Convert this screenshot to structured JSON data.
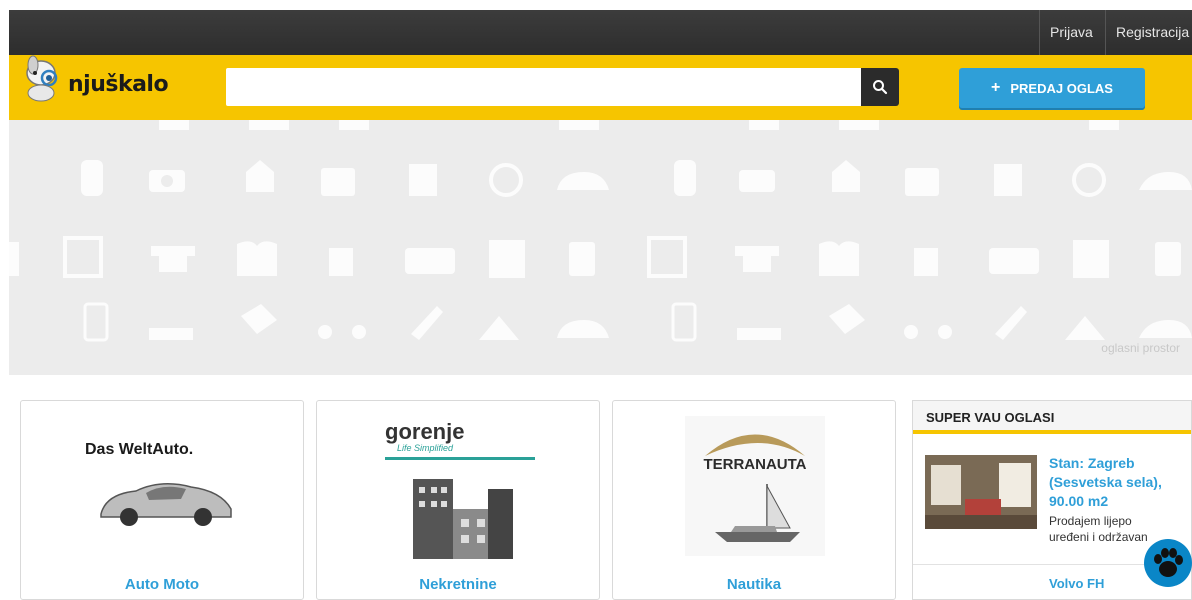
{
  "header": {
    "links": [
      "Prijava",
      "Registracija"
    ],
    "logo_text": "njuškalo",
    "search": {
      "value": "",
      "placeholder": ""
    },
    "submit_button": {
      "icon": "+",
      "label": "PREDAJ OGLAS"
    }
  },
  "ad_space": {
    "label": "oglasni prostor"
  },
  "categories": [
    {
      "brand": "Das WeltAuto.",
      "title": "Auto Moto"
    },
    {
      "brand": "gorenje",
      "tagline": "Life Simplified",
      "title": "Nekretnine"
    },
    {
      "brand": "TERRANAUTA",
      "title": "Nautika"
    }
  ],
  "sidebar": {
    "heading": "SUPER VAU OGLASI",
    "items": [
      {
        "title": "Stan: Zagreb (Sesvetska sela), 90.00 m2",
        "desc": "Prodajem lijepo uređeni i održavan"
      },
      {
        "title": "Volvo FH"
      }
    ]
  },
  "colors": {
    "brand_yellow": "#f6c500",
    "accent_blue": "#2f9fd8",
    "topbar": "#333333"
  }
}
